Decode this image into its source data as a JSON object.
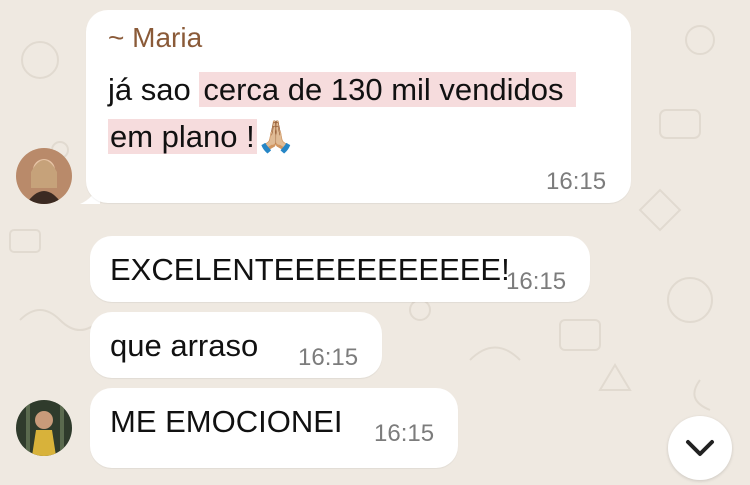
{
  "chat": {
    "messages": [
      {
        "sender": "~ Maria",
        "line1_plain": "já sao ",
        "line1_highlight": "cerca de 130 mil vendidos",
        "line2_highlight": "em plano !",
        "emoji": "🙏🏼",
        "time": "16:15"
      },
      {
        "text": "EXCELENTEEEEEEEEEEE!",
        "time": "16:15"
      },
      {
        "text": "que arraso",
        "time": "16:15"
      },
      {
        "text": "ME EMOCIONEI",
        "time": "16:15"
      }
    ]
  },
  "colors": {
    "background": "#efe9e1",
    "bubble": "#ffffff",
    "sender_name": "#8a5a38",
    "highlight": "#f6dcdd",
    "timestamp": "#7c7c7c"
  },
  "icons": {
    "scroll_down": "chevron-down-icon"
  }
}
